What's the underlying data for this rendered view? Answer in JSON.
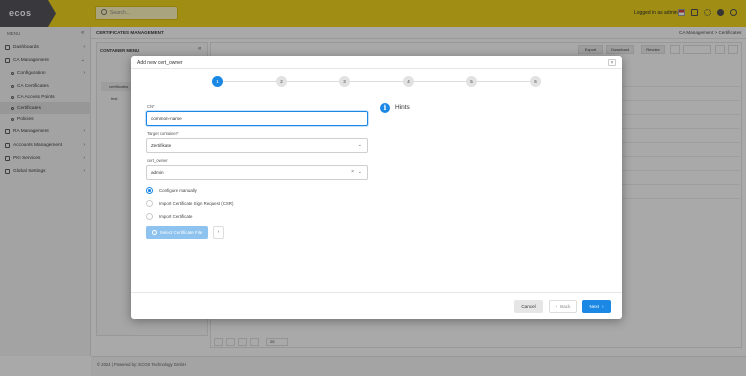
{
  "header": {
    "logo": "ecos",
    "search_placeholder": "Search...",
    "login_text": "Logged in as admin"
  },
  "sidebar": {
    "title": "MENU",
    "items": [
      {
        "label": "Dashboards",
        "level": 0
      },
      {
        "label": "CA Management",
        "level": 0
      },
      {
        "label": "Configuration",
        "level": 1
      },
      {
        "label": "CA Certificates",
        "level": 1
      },
      {
        "label": "CA Access Points",
        "level": 1
      },
      {
        "label": "Certificates",
        "level": 1,
        "active": true
      },
      {
        "label": "Policies",
        "level": 1
      },
      {
        "label": "RA Management",
        "level": 0
      },
      {
        "label": "Accounts Management",
        "level": 0
      },
      {
        "label": "PKI Services",
        "level": 0
      },
      {
        "label": "Global Settings",
        "level": 0
      }
    ]
  },
  "breadcrumb": {
    "page_title": "CERTIFICATES MANAGEMENT",
    "path": "CA Management  >  Certificates"
  },
  "content": {
    "left_panel_title": "CONTAINER MENU",
    "tree_item": "certificates",
    "tree_sub": "test",
    "toolbar": {
      "btn1": "Export",
      "btn2": "Download",
      "btn3": "Revoke"
    },
    "page_size": "25"
  },
  "footer": {
    "text": "© 2024 | Powered by: ECOS Technology GmbH"
  },
  "modal": {
    "title": "Add new cert_owner",
    "steps": [
      "1",
      "2",
      "3",
      "4",
      "5",
      "6"
    ],
    "active_step": 1,
    "fields": [
      {
        "label": "CN*",
        "value": "common-name"
      },
      {
        "label": "Target container*",
        "value": "Zertifikate"
      },
      {
        "label": "cert_owner",
        "value": "admin"
      }
    ],
    "radios": [
      {
        "label": "Configure manually",
        "checked": true
      },
      {
        "label": "Import Certificate Sign Request (CSR)",
        "checked": false
      },
      {
        "label": "Import Certificate",
        "checked": false
      }
    ],
    "select_file_label": "Select Certificate File",
    "hints_title": "Hints",
    "buttons": {
      "cancel": "Cancel",
      "back": "Back",
      "next": "Next"
    },
    "colors": {
      "accent": "#1c88e6",
      "brand": "#f0d20f"
    }
  }
}
